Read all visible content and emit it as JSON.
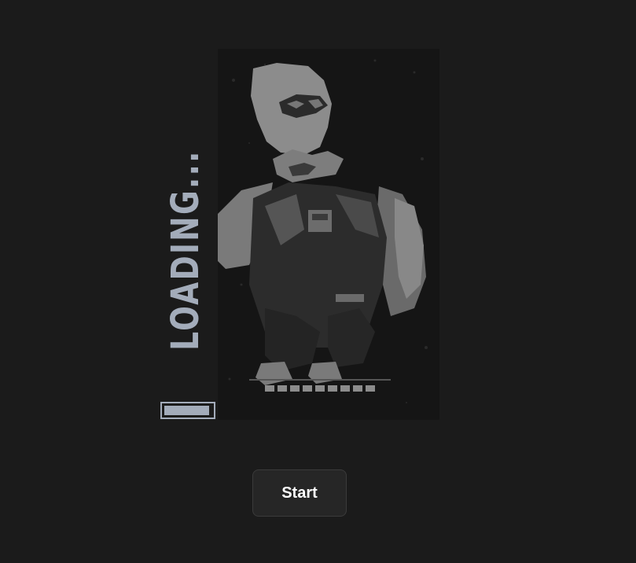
{
  "loader": {
    "text": "LOADING...",
    "progress_fraction": 0.95,
    "color": "#a3acba"
  },
  "poster": {
    "subject": "hooded-figure-crouching"
  },
  "start_button": {
    "label": "Start"
  },
  "colors": {
    "background": "#1b1b1b",
    "poster_bg": "#151515",
    "button_bg": "#262626",
    "button_border": "#3b3b3b",
    "button_text": "#ffffff"
  }
}
